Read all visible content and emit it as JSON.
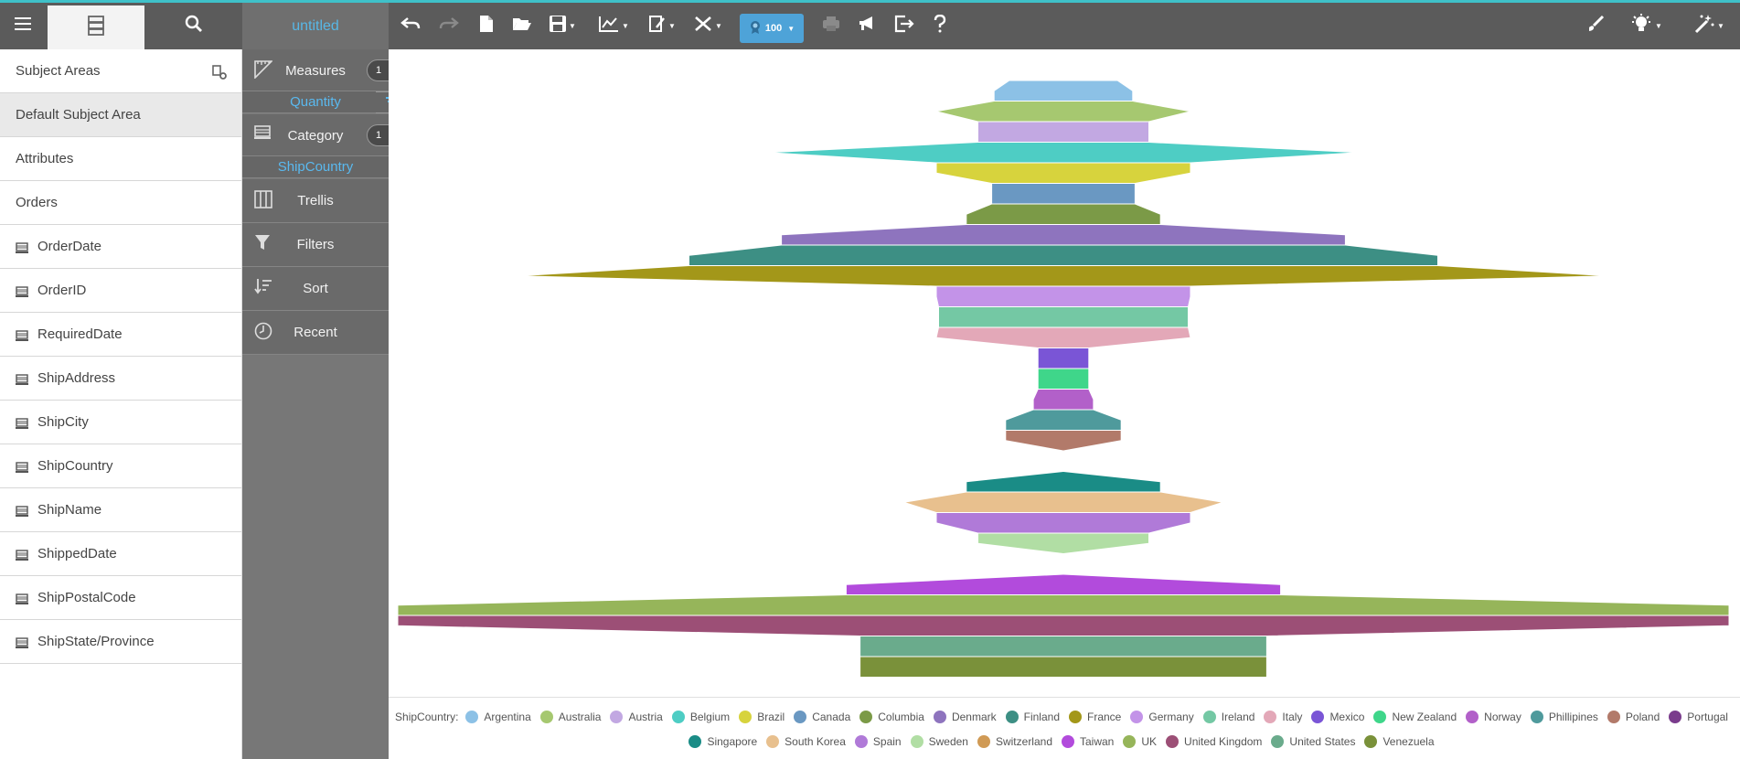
{
  "topbar": {
    "document_title": "untitled",
    "badge_value": "100",
    "colors": {
      "accent": "#3fc1c9",
      "title": "#58b7e6",
      "badge": "#4ea3d8"
    }
  },
  "left_panel": {
    "header": "Subject Areas",
    "items": [
      {
        "label": "Default Subject Area",
        "selected": true,
        "is_field": false
      },
      {
        "label": "Attributes",
        "selected": false,
        "is_field": false
      },
      {
        "label": "Orders",
        "selected": false,
        "is_field": false
      },
      {
        "label": "OrderDate",
        "selected": false,
        "is_field": true
      },
      {
        "label": "OrderID",
        "selected": false,
        "is_field": true
      },
      {
        "label": "RequiredDate",
        "selected": false,
        "is_field": true
      },
      {
        "label": "ShipAddress",
        "selected": false,
        "is_field": true
      },
      {
        "label": "ShipCity",
        "selected": false,
        "is_field": true
      },
      {
        "label": "ShipCountry",
        "selected": false,
        "is_field": true
      },
      {
        "label": "ShipName",
        "selected": false,
        "is_field": true
      },
      {
        "label": "ShippedDate",
        "selected": false,
        "is_field": true
      },
      {
        "label": "ShipPostalCode",
        "selected": false,
        "is_field": true
      },
      {
        "label": "ShipState/Province",
        "selected": false,
        "is_field": true
      }
    ]
  },
  "binding_panel": {
    "measures": {
      "label": "Measures",
      "count": "1",
      "field": "Quantity"
    },
    "category": {
      "label": "Category",
      "count": "1",
      "field": "ShipCountry"
    },
    "trellis": "Trellis",
    "filters": "Filters",
    "sort": "Sort",
    "recent": "Recent"
  },
  "chart_data": {
    "type": "funnel",
    "legend_title": "ShipCountry:",
    "categories": [
      "Argentina",
      "Australia",
      "Austria",
      "Belgium",
      "Brazil",
      "Canada",
      "Columbia",
      "Denmark",
      "Finland",
      "France",
      "Germany",
      "Ireland",
      "Italy",
      "Mexico",
      "New Zealand",
      "Norway",
      "Phillipines",
      "Poland",
      "Portugal",
      "Singapore",
      "South Korea",
      "Spain",
      "Sweden",
      "Switzerland",
      "Taiwan",
      "UK",
      "United Kingdom",
      "United States",
      "Venezuela"
    ],
    "values": [
      150,
      275,
      185,
      640,
      275,
      155,
      210,
      610,
      810,
      1180,
      275,
      270,
      275,
      55,
      55,
      65,
      125,
      125,
      0.1,
      210,
      345,
      275,
      185,
      0.1,
      470,
      1440,
      1440,
      440,
      440
    ],
    "colors": [
      "#8cc1e6",
      "#a6c870",
      "#c2a8e2",
      "#4ecdc4",
      "#d7d33d",
      "#6a98c2",
      "#7b9a47",
      "#8e74be",
      "#3d8f84",
      "#a39719",
      "#c393e8",
      "#74c8a4",
      "#e3a8b8",
      "#7a55d6",
      "#3fd68a",
      "#b260c9",
      "#4f9a9c",
      "#b27a6a",
      "#7a3c8c",
      "#1a8c86",
      "#e8c08e",
      "#b07ad8",
      "#b1dea4",
      "#d09a55",
      "#b24bdc",
      "#96b55a",
      "#9c4f76",
      "#6aab8c",
      "#7a913a"
    ]
  }
}
